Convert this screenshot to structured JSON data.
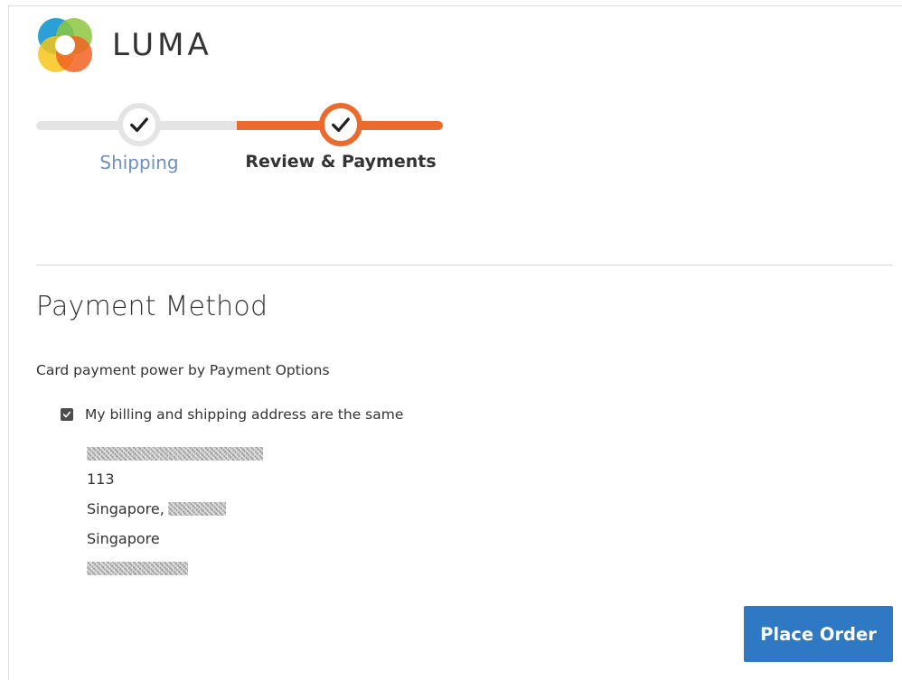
{
  "brand": {
    "name": "LUMA",
    "colors": {
      "logo_blue": "#1f9ad6",
      "logo_green": "#8dc63f",
      "logo_yellow": "#f7c61a",
      "logo_orange": "#f26322",
      "accent_orange": "#ec6a2d",
      "button_blue": "#2f78c4",
      "link_blue": "#6f8fbe"
    }
  },
  "progress": {
    "steps": [
      {
        "label": "Shipping",
        "state": "complete",
        "icon": "checkmark-icon"
      },
      {
        "label": "Review & Payments",
        "state": "active",
        "icon": "checkmark-icon"
      }
    ]
  },
  "payment": {
    "title": "Payment Method",
    "method_name": "Card payment power by Payment Options",
    "billing_same_label": "My billing and shipping address are the same",
    "billing_same_checked": true,
    "address": {
      "street": "113",
      "city": "Singapore,",
      "country": "Singapore"
    }
  },
  "actions": {
    "place_order_label": "Place Order"
  }
}
